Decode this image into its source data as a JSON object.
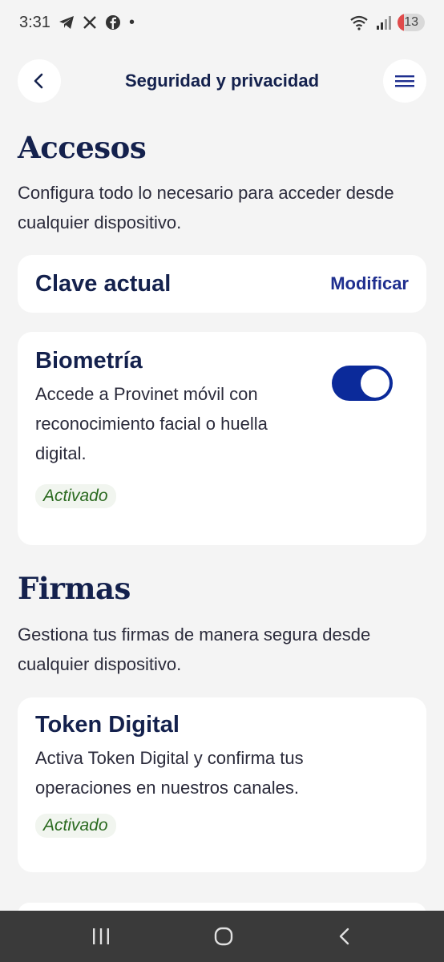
{
  "status_bar": {
    "time": "3:31",
    "battery": "13",
    "left_icons": [
      "telegram-icon",
      "x-icon",
      "facebook-icon",
      "dot-icon"
    ],
    "right_icons": [
      "wifi-icon",
      "signal-icon",
      "battery-icon"
    ]
  },
  "header": {
    "title": "Seguridad y privacidad",
    "back_icon": "chevron-left-icon",
    "menu_icon": "menu-icon"
  },
  "accesos": {
    "title": "Accesos",
    "description": "Configura todo lo necesario para acceder desde cualquier dispositivo.",
    "clave": {
      "title": "Clave actual",
      "action": "Modificar"
    },
    "biometria": {
      "title": "Biometría",
      "description": "Accede a Provinet móvil con reconocimiento facial o huella digital.",
      "status": "Activado",
      "toggle_on": true
    }
  },
  "firmas": {
    "title": "Firmas",
    "description": "Gestiona tus firmas de manera segura desde cualquier dispositivo.",
    "token": {
      "title": "Token Digital",
      "description": "Activa Token Digital y confirma tus operaciones en nuestros canales.",
      "status": "Activado"
    }
  },
  "nav": {
    "recents_icon": "recents-icon",
    "home_icon": "home-icon",
    "back_icon": "back-icon"
  },
  "colors": {
    "primary": "#14214d",
    "accent": "#0b2a9a",
    "link": "#1f2f8f",
    "success": "#2a6a1f"
  }
}
